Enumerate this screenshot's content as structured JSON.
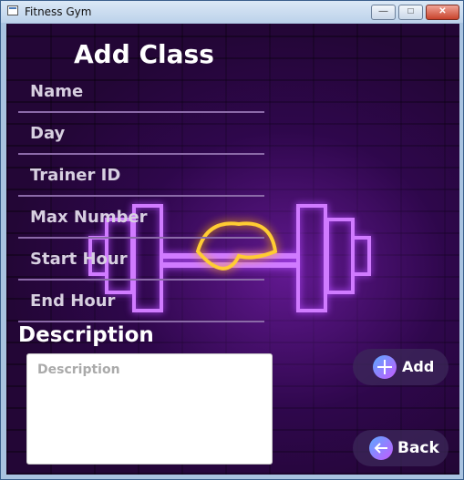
{
  "window": {
    "title": "Fitness Gym",
    "min_glyph": "—",
    "max_glyph": "□",
    "close_glyph": "✕"
  },
  "form": {
    "heading": "Add Class",
    "fields": [
      {
        "label": "Name"
      },
      {
        "label": "Day"
      },
      {
        "label": "Trainer ID"
      },
      {
        "label": "Max Number"
      },
      {
        "label": "Start Hour"
      },
      {
        "label": "End Hour"
      }
    ],
    "description_heading": "Description",
    "description_placeholder": "Description"
  },
  "actions": {
    "add_label": "Add",
    "back_label": "Back",
    "add_icon": "plus-icon",
    "back_icon": "arrow-left-icon"
  },
  "colors": {
    "background": "#230636",
    "neon_purple": "#b44bff",
    "neon_yellow": "#ffcc33",
    "pill": "#3c285a"
  }
}
